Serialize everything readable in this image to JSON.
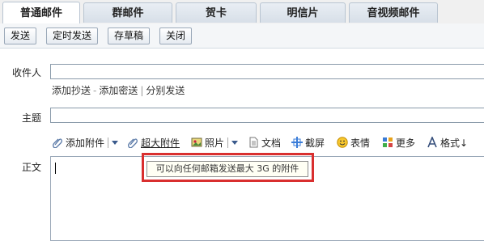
{
  "tabs": [
    {
      "label": "普通邮件",
      "active": true
    },
    {
      "label": "群邮件",
      "active": false
    },
    {
      "label": "贺卡",
      "active": false
    },
    {
      "label": "明信片",
      "active": false
    },
    {
      "label": "音视频邮件",
      "active": false
    }
  ],
  "toolbar": {
    "send": "发送",
    "scheduled_send": "定时发送",
    "save_draft": "存草稿",
    "close": "关闭"
  },
  "form": {
    "recipient_label": "收件人",
    "recipient_value": "",
    "add_cc": "添加抄送",
    "add_bcc": "添加密送",
    "separate_send": "分别发送",
    "subject_label": "主题",
    "subject_value": "",
    "body_label": "正文",
    "body_value": ""
  },
  "editor_toolbar": {
    "attachment": "添加附件",
    "large_attachment": "超大附件",
    "photo": "照片",
    "document": "文档",
    "screenshot": "截屏",
    "emoticon": "表情",
    "more": "更多",
    "format": "格式↓"
  },
  "tooltip": {
    "text": "可以向任何邮箱发送最大 3G 的附件"
  },
  "colors": {
    "highlight": "#d92f2f",
    "link_dark": "#333333",
    "arrow": "#3a5a8c"
  },
  "icons": {
    "attachment": "paperclip-icon",
    "large_attachment": "paperclip-icon",
    "photo": "image-icon",
    "document": "document-icon",
    "screenshot": "scissors-icon",
    "emoticon": "smiley-icon",
    "more": "grid-icon",
    "format": "text-format-icon"
  }
}
